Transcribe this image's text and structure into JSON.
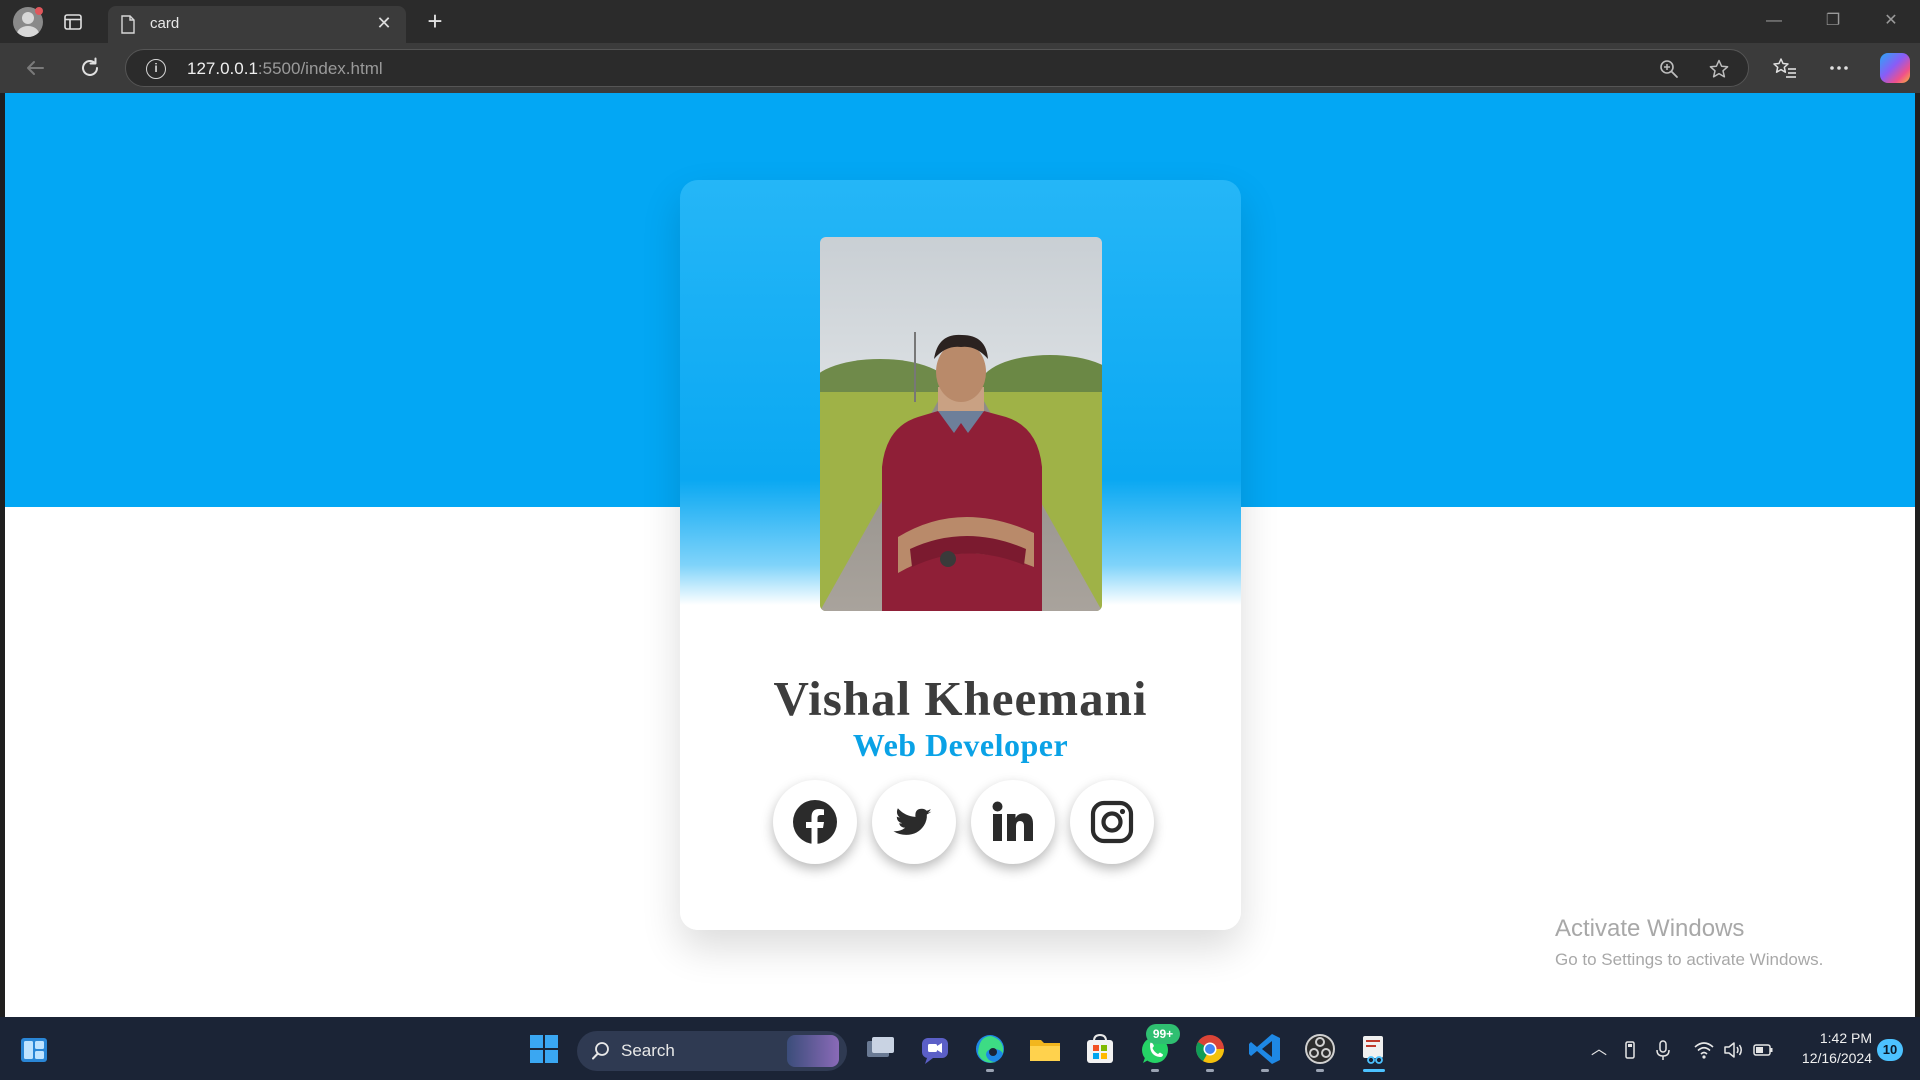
{
  "browser": {
    "tab": {
      "title": "card",
      "icon": "page-icon"
    },
    "url_host": "127.0.0.1",
    "url_rest": ":5500/index.html",
    "icons": [
      "back-icon",
      "refresh-icon",
      "info-icon",
      "zoom-icon",
      "star-icon",
      "favorites-icon",
      "more-icon",
      "copilot-icon"
    ]
  },
  "card": {
    "name": "Vishal Kheemani",
    "role": "Web Developer",
    "photo_description": "profile-photo",
    "socials": [
      {
        "name": "facebook-icon"
      },
      {
        "name": "twitter-icon"
      },
      {
        "name": "linkedin-icon"
      },
      {
        "name": "instagram-icon"
      }
    ],
    "colors": {
      "band": "#03a7f4",
      "role": "#0aa2e6",
      "name": "#3d3d3d"
    }
  },
  "watermark": {
    "title": "Activate Windows",
    "subtitle": "Go to Settings to activate Windows."
  },
  "taskbar": {
    "search_label": "Search",
    "whatsapp_badge": "99+",
    "time": "1:42 PM",
    "date": "12/16/2024",
    "notification_count": "10"
  }
}
